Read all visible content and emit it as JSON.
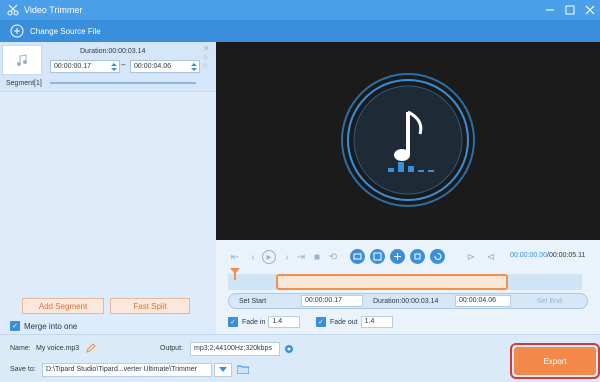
{
  "window": {
    "title": "Video Trimmer"
  },
  "toolbar": {
    "change_source": "Change Source File"
  },
  "segment": {
    "duration": "Duration:00:00:03.14",
    "start": "00:00:00.17",
    "end": "00:00:04.06",
    "label": "Segment[1]"
  },
  "left_actions": {
    "add_segment": "Add Segment",
    "fast_split": "Fast Split",
    "merge_label": "Merge into one"
  },
  "player": {
    "current_time": "00:00:00.00",
    "separator": "/",
    "total_time": "00:00:05.11"
  },
  "trim_row": {
    "set_start": "Set Start",
    "start_value": "00:00:00.17",
    "duration": "Duration:00:00:03.14",
    "end_value": "00:00:04.06",
    "set_end": "Set End"
  },
  "fade": {
    "fade_in_label": "Fade in",
    "fade_in_value": "1.4",
    "fade_out_label": "Fade out",
    "fade_out_value": "1.4"
  },
  "bottom": {
    "name_label": "Name:",
    "name_value": "My voice.mp3",
    "output_label": "Output:",
    "output_value": "mp3;2;44100Hz;320kbps",
    "save_label": "Save to:",
    "save_path": "D:\\Tipard Studio\\Tipard...verter Ultimate\\Trimmer",
    "export": "Export"
  },
  "colors": {
    "accent": "#3a8fdc",
    "export": "#f2894a",
    "highlight_box": "#d53a3a"
  },
  "icons": [
    "app-icon",
    "minimize-icon",
    "close-icon",
    "add-circle-icon",
    "music-note-icon",
    "play-icon",
    "settings-icon",
    "folder-icon"
  ]
}
